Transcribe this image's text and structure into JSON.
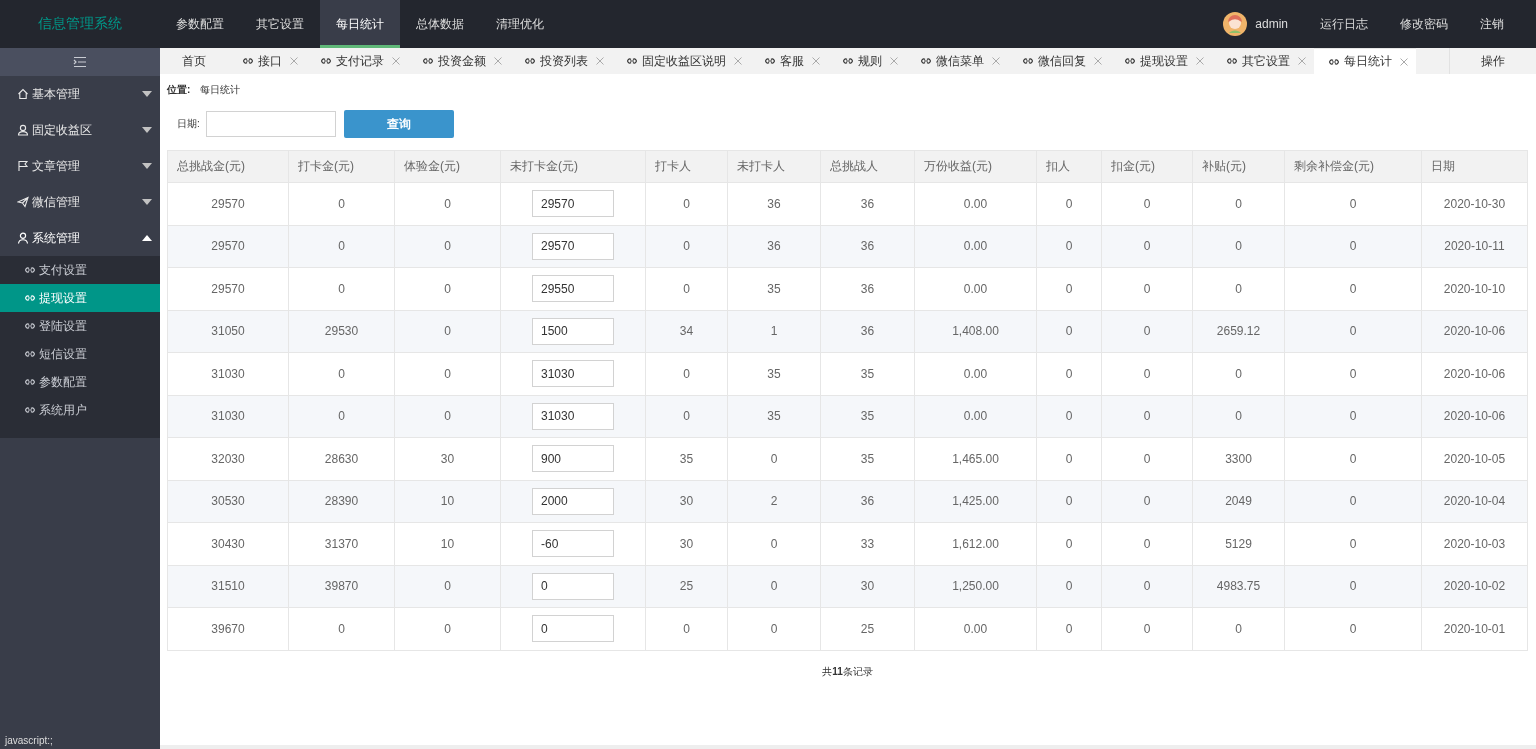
{
  "header": {
    "logo": "信息管理系统",
    "nav": [
      {
        "label": "参数配置",
        "selected": false
      },
      {
        "label": "其它设置",
        "selected": false
      },
      {
        "label": "每日统计",
        "selected": true
      },
      {
        "label": "总体数据",
        "selected": false
      },
      {
        "label": "清理优化",
        "selected": false
      }
    ],
    "user": "admin",
    "links": [
      "运行日志",
      "修改密码",
      "注销"
    ]
  },
  "sidebar": {
    "items": [
      {
        "label": "基本管理",
        "expanded": false
      },
      {
        "label": "固定收益区",
        "expanded": false
      },
      {
        "label": "文章管理",
        "expanded": false
      },
      {
        "label": "微信管理",
        "expanded": false
      },
      {
        "label": "系统管理",
        "expanded": true,
        "children": [
          {
            "label": "支付设置",
            "selected": false
          },
          {
            "label": "提现设置",
            "selected": true
          },
          {
            "label": "登陆设置",
            "selected": false
          },
          {
            "label": "短信设置",
            "selected": false
          },
          {
            "label": "参数配置",
            "selected": false
          },
          {
            "label": "系统用户",
            "selected": false
          }
        ]
      }
    ]
  },
  "tabs": [
    {
      "label": "首页",
      "kind": "home",
      "selected": false
    },
    {
      "label": "接口",
      "kind": "page",
      "selected": false
    },
    {
      "label": "支付记录",
      "kind": "page",
      "selected": false
    },
    {
      "label": "投资金额",
      "kind": "page",
      "selected": false
    },
    {
      "label": "投资列表",
      "kind": "page",
      "selected": false
    },
    {
      "label": "固定收益区说明",
      "kind": "page",
      "selected": false
    },
    {
      "label": "客服",
      "kind": "page",
      "selected": false
    },
    {
      "label": "规则",
      "kind": "page",
      "selected": false
    },
    {
      "label": "微信菜单",
      "kind": "page",
      "selected": false
    },
    {
      "label": "微信回复",
      "kind": "page",
      "selected": false
    },
    {
      "label": "提现设置",
      "kind": "page",
      "selected": false
    },
    {
      "label": "其它设置",
      "kind": "page",
      "selected": false
    },
    {
      "label": "每日统计",
      "kind": "page",
      "selected": true
    }
  ],
  "tab_actions": "操作",
  "breadcrumb": {
    "label": "位置:",
    "current": "每日统计"
  },
  "search": {
    "label": "日期:",
    "button": "查询"
  },
  "table": {
    "columns": [
      {
        "label": "总挑战金(元)",
        "kind": "text"
      },
      {
        "label": "打卡金(元)",
        "kind": "text"
      },
      {
        "label": "体验金(元)",
        "kind": "text"
      },
      {
        "label": "未打卡金(元)",
        "kind": "input"
      },
      {
        "label": "打卡人",
        "kind": "text"
      },
      {
        "label": "未打卡人",
        "kind": "text"
      },
      {
        "label": "总挑战人",
        "kind": "text"
      },
      {
        "label": "万份收益(元)",
        "kind": "text"
      },
      {
        "label": "扣人",
        "kind": "text"
      },
      {
        "label": "扣金(元)",
        "kind": "text"
      },
      {
        "label": "补贴(元)",
        "kind": "text"
      },
      {
        "label": "剩余补偿金(元)",
        "kind": "text"
      },
      {
        "label": "日期",
        "kind": "text"
      }
    ],
    "rows": [
      [
        "29570",
        "0",
        "0",
        "29570",
        "0",
        "36",
        "36",
        "0.00",
        "0",
        "0",
        "0",
        "0",
        "2020-10-30"
      ],
      [
        "29570",
        "0",
        "0",
        "29570",
        "0",
        "36",
        "36",
        "0.00",
        "0",
        "0",
        "0",
        "0",
        "2020-10-11"
      ],
      [
        "29570",
        "0",
        "0",
        "29550",
        "0",
        "35",
        "36",
        "0.00",
        "0",
        "0",
        "0",
        "0",
        "2020-10-10"
      ],
      [
        "31050",
        "29530",
        "0",
        "1500",
        "34",
        "1",
        "36",
        "1,408.00",
        "0",
        "0",
        "2659.12",
        "0",
        "2020-10-06"
      ],
      [
        "31030",
        "0",
        "0",
        "31030",
        "0",
        "35",
        "35",
        "0.00",
        "0",
        "0",
        "0",
        "0",
        "2020-10-06"
      ],
      [
        "31030",
        "0",
        "0",
        "31030",
        "0",
        "35",
        "35",
        "0.00",
        "0",
        "0",
        "0",
        "0",
        "2020-10-06"
      ],
      [
        "32030",
        "28630",
        "30",
        "900",
        "35",
        "0",
        "35",
        "1,465.00",
        "0",
        "0",
        "3300",
        "0",
        "2020-10-05"
      ],
      [
        "30530",
        "28390",
        "10",
        "2000",
        "30",
        "2",
        "36",
        "1,425.00",
        "0",
        "0",
        "2049",
        "0",
        "2020-10-04"
      ],
      [
        "30430",
        "31370",
        "10",
        "-60",
        "30",
        "0",
        "33",
        "1,612.00",
        "0",
        "0",
        "5129",
        "0",
        "2020-10-03"
      ],
      [
        "31510",
        "39870",
        "0",
        "0",
        "25",
        "0",
        "30",
        "1,250.00",
        "0",
        "0",
        "4983.75",
        "0",
        "2020-10-02"
      ],
      [
        "39670",
        "0",
        "0",
        "0",
        "0",
        "0",
        "25",
        "0.00",
        "0",
        "0",
        "0",
        "0",
        "2020-10-01"
      ]
    ]
  },
  "footer": {
    "prefix": "共",
    "count": "11",
    "suffix": "条记录"
  },
  "status_bar": "javascript:;"
}
